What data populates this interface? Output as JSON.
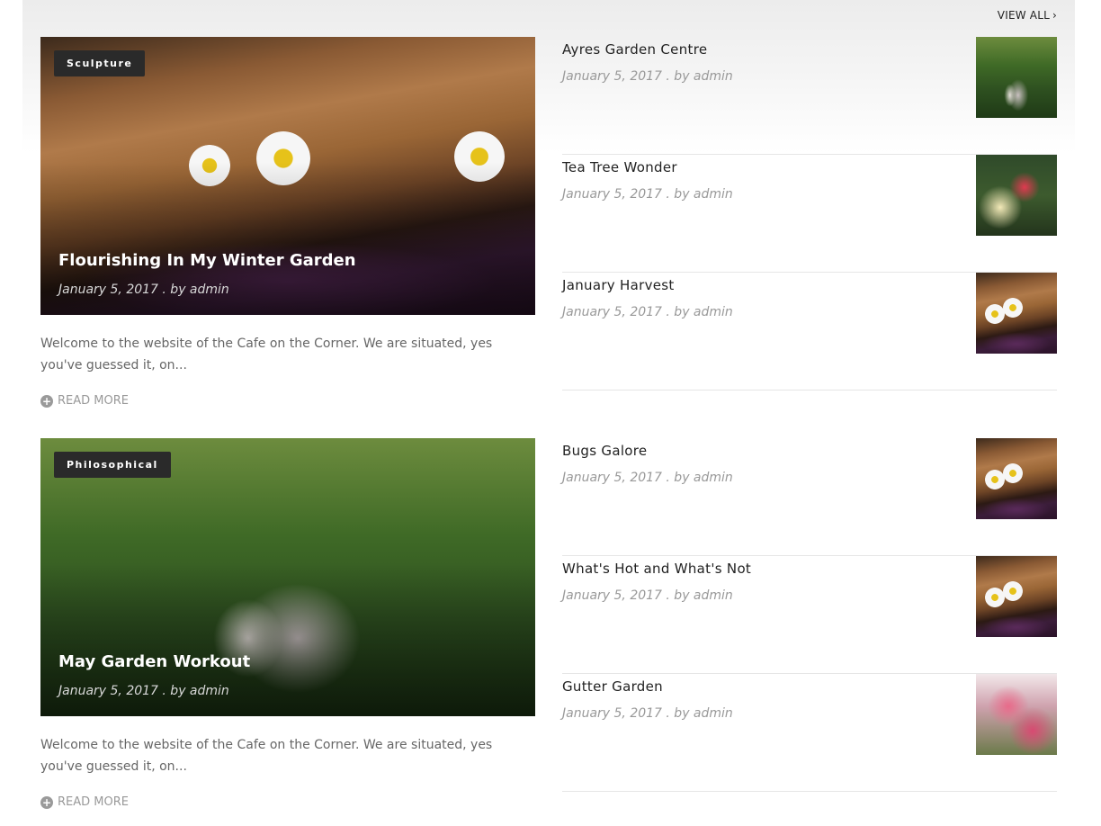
{
  "header": {
    "view_all": "VIEW ALL"
  },
  "sections": [
    {
      "feature": {
        "category": "Sculpture",
        "title": "Flourishing In My Winter Garden",
        "meta": "January 5, 2017 . by admin",
        "excerpt": "Welcome to the website of the Cafe on the Corner. We are situated, yes you've guessed it, on...",
        "read_more": "READ MORE"
      },
      "items": [
        {
          "title": "Ayres Garden Centre",
          "meta": "January 5, 2017 . by admin"
        },
        {
          "title": "Tea Tree Wonder",
          "meta": "January 5, 2017 . by admin"
        },
        {
          "title": "January Harvest",
          "meta": "January 5, 2017 . by admin"
        }
      ]
    },
    {
      "feature": {
        "category": "Philosophical",
        "title": "May Garden Workout",
        "meta": "January 5, 2017 . by admin",
        "excerpt": "Welcome to the website of the Cafe on the Corner. We are situated, yes you've guessed it, on...",
        "read_more": "READ MORE"
      },
      "items": [
        {
          "title": "Bugs Galore",
          "meta": "January 5, 2017 . by admin"
        },
        {
          "title": "What's Hot and What's Not",
          "meta": "January 5, 2017 . by admin"
        },
        {
          "title": "Gutter Garden",
          "meta": "January 5, 2017 . by admin"
        }
      ]
    }
  ]
}
